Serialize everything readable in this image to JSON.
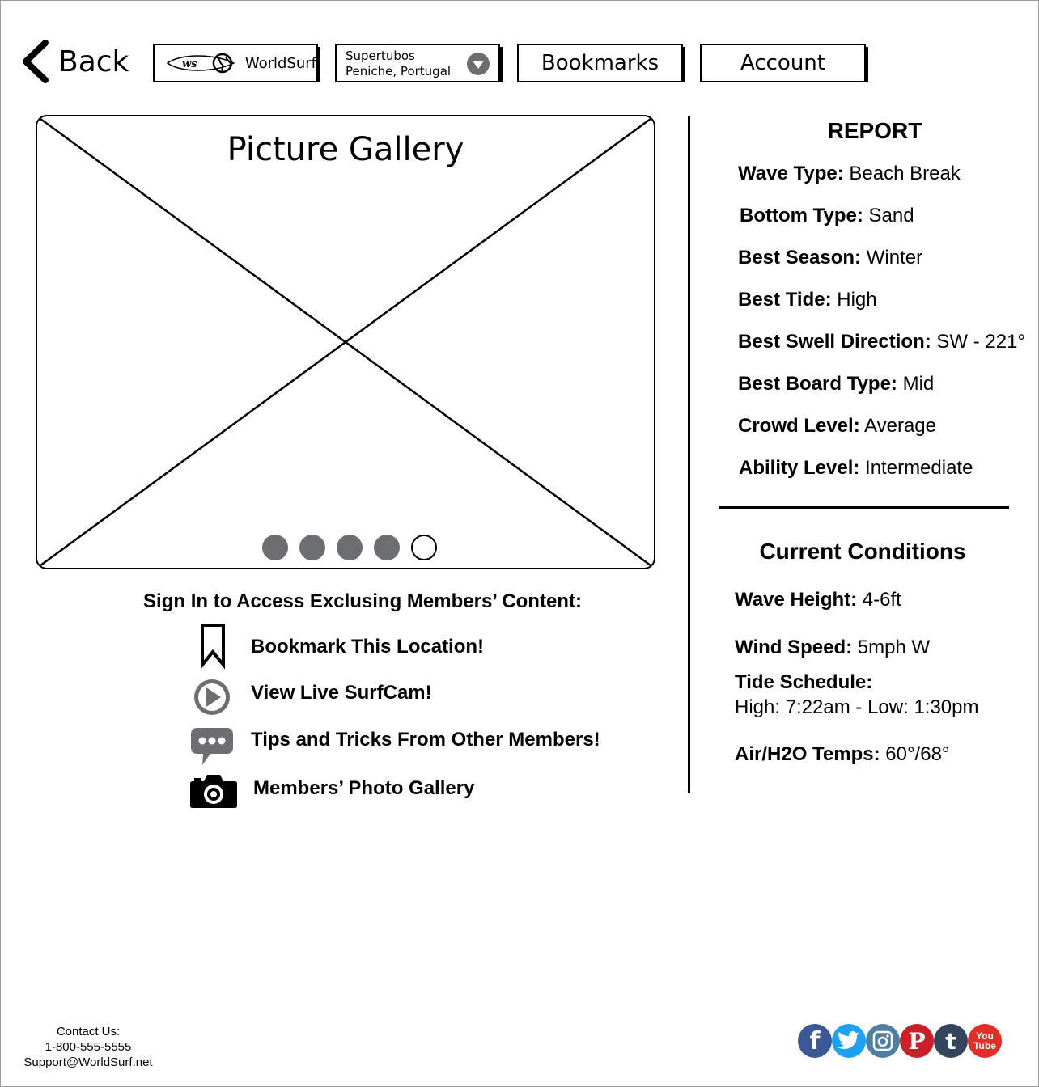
{
  "header": {
    "back_label": "Back",
    "logo_text": "WorldSurf",
    "logo_mark": "ws",
    "location": {
      "line1": "Supertubos",
      "line2": "Peniche, Portugal"
    },
    "bookmarks_label": "Bookmarks",
    "account_label": "Account"
  },
  "gallery": {
    "title": "Picture Gallery",
    "slide_count": 5,
    "active_slide": 5
  },
  "members": {
    "heading": "Sign In to Access Exclusing Members’ Content:",
    "features": [
      {
        "label": "Bookmark This Location!",
        "icon": "bookmark-icon"
      },
      {
        "label": "View Live SurfCam!",
        "icon": "play-icon"
      },
      {
        "label": "Tips and Tricks From Other Members!",
        "icon": "chat-bubble-icon"
      },
      {
        "label": "Members’ Photo Gallery",
        "icon": "camera-icon"
      }
    ]
  },
  "report": {
    "title": "REPORT",
    "rows": [
      {
        "label": "Wave Type:",
        "value": " Beach Break"
      },
      {
        "label": "Bottom Type:",
        "value": " Sand"
      },
      {
        "label": "Best Season:",
        "value": " Winter"
      },
      {
        "label": "Best Tide:",
        "value": " High"
      },
      {
        "label": "Best Swell Direction:",
        "value": " SW - 221°"
      },
      {
        "label": "Best Board Type:",
        "value": " Mid"
      },
      {
        "label": "Crowd Level:",
        "value": " Average"
      },
      {
        "label": "Ability Level:",
        "value": " Intermediate"
      }
    ]
  },
  "conditions": {
    "title": "Current Conditions",
    "wave_height": {
      "label": "Wave Height:",
      "value": " 4-6ft"
    },
    "wind_speed": {
      "label": "Wind Speed:",
      "value": " 5mph W"
    },
    "tide": {
      "label": "Tide Schedule:",
      "value": "High: 7:22am - Low: 1:30pm"
    },
    "temps": {
      "label": "Air/H2O Temps:",
      "value": " 60°/68°"
    }
  },
  "footer": {
    "contact_label": "Contact Us:",
    "phone": "1-800-555-5555",
    "email": "Support@WorldSurf.net",
    "social": [
      {
        "name": "facebook-icon",
        "glyph": "f",
        "color": "#3b5998"
      },
      {
        "name": "twitter-icon",
        "glyph": "t",
        "color": "#1da1f2"
      },
      {
        "name": "instagram-icon",
        "glyph": "",
        "color": "#517fa4"
      },
      {
        "name": "pinterest-icon",
        "glyph": "P",
        "color": "#cb2027"
      },
      {
        "name": "tumblr-icon",
        "glyph": "t",
        "color": "#35465c"
      },
      {
        "name": "youtube-icon",
        "glyph": "You Tube",
        "color": "#e52d27"
      }
    ]
  }
}
